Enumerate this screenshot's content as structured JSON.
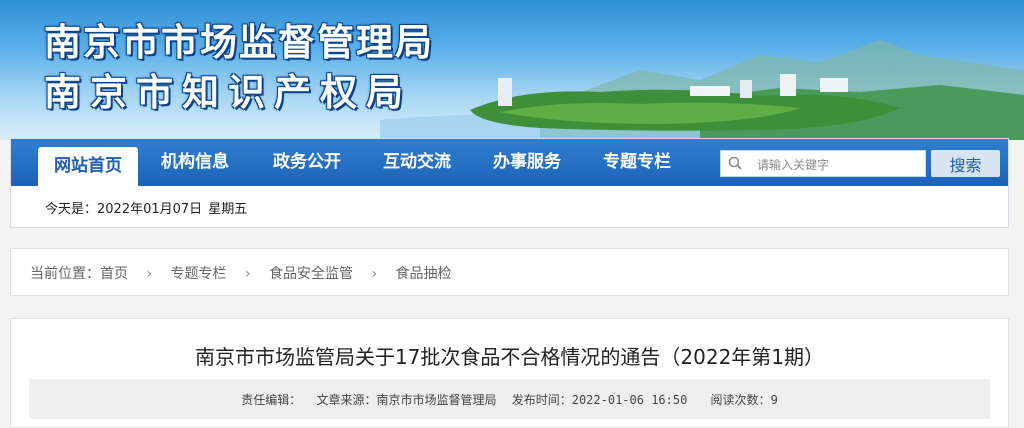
{
  "banner": {
    "title_line1": "南京市市场监督管理局",
    "title_line2": "南京市知识产权局"
  },
  "nav": {
    "items": [
      {
        "label": "网站首页",
        "active": true
      },
      {
        "label": "机构信息"
      },
      {
        "label": "政务公开"
      },
      {
        "label": "互动交流"
      },
      {
        "label": "办事服务"
      },
      {
        "label": "专题专栏"
      }
    ],
    "search_placeholder": "请输入关键字",
    "search_button": "搜索"
  },
  "date": {
    "prefix": "今天是：",
    "date": "2022年01月07日",
    "weekday": "星期五"
  },
  "breadcrumb": {
    "label": "当前位置：",
    "items": [
      "首页",
      "专题专栏",
      "食品安全监管",
      "食品抽检"
    ]
  },
  "article": {
    "title": "南京市市场监管局关于17批次食品不合格情况的通告（2022年第1期）",
    "editor_label": "责任编辑：",
    "source_label": "文章来源：",
    "source": "南京市市场监督管理局",
    "published_label": "发布时间：",
    "published": "2022-01-06 16:50",
    "views_label": "阅读次数：",
    "views": "9"
  },
  "colors": {
    "nav_blue": "#1d63b8",
    "accent": "#1d5fb2"
  }
}
